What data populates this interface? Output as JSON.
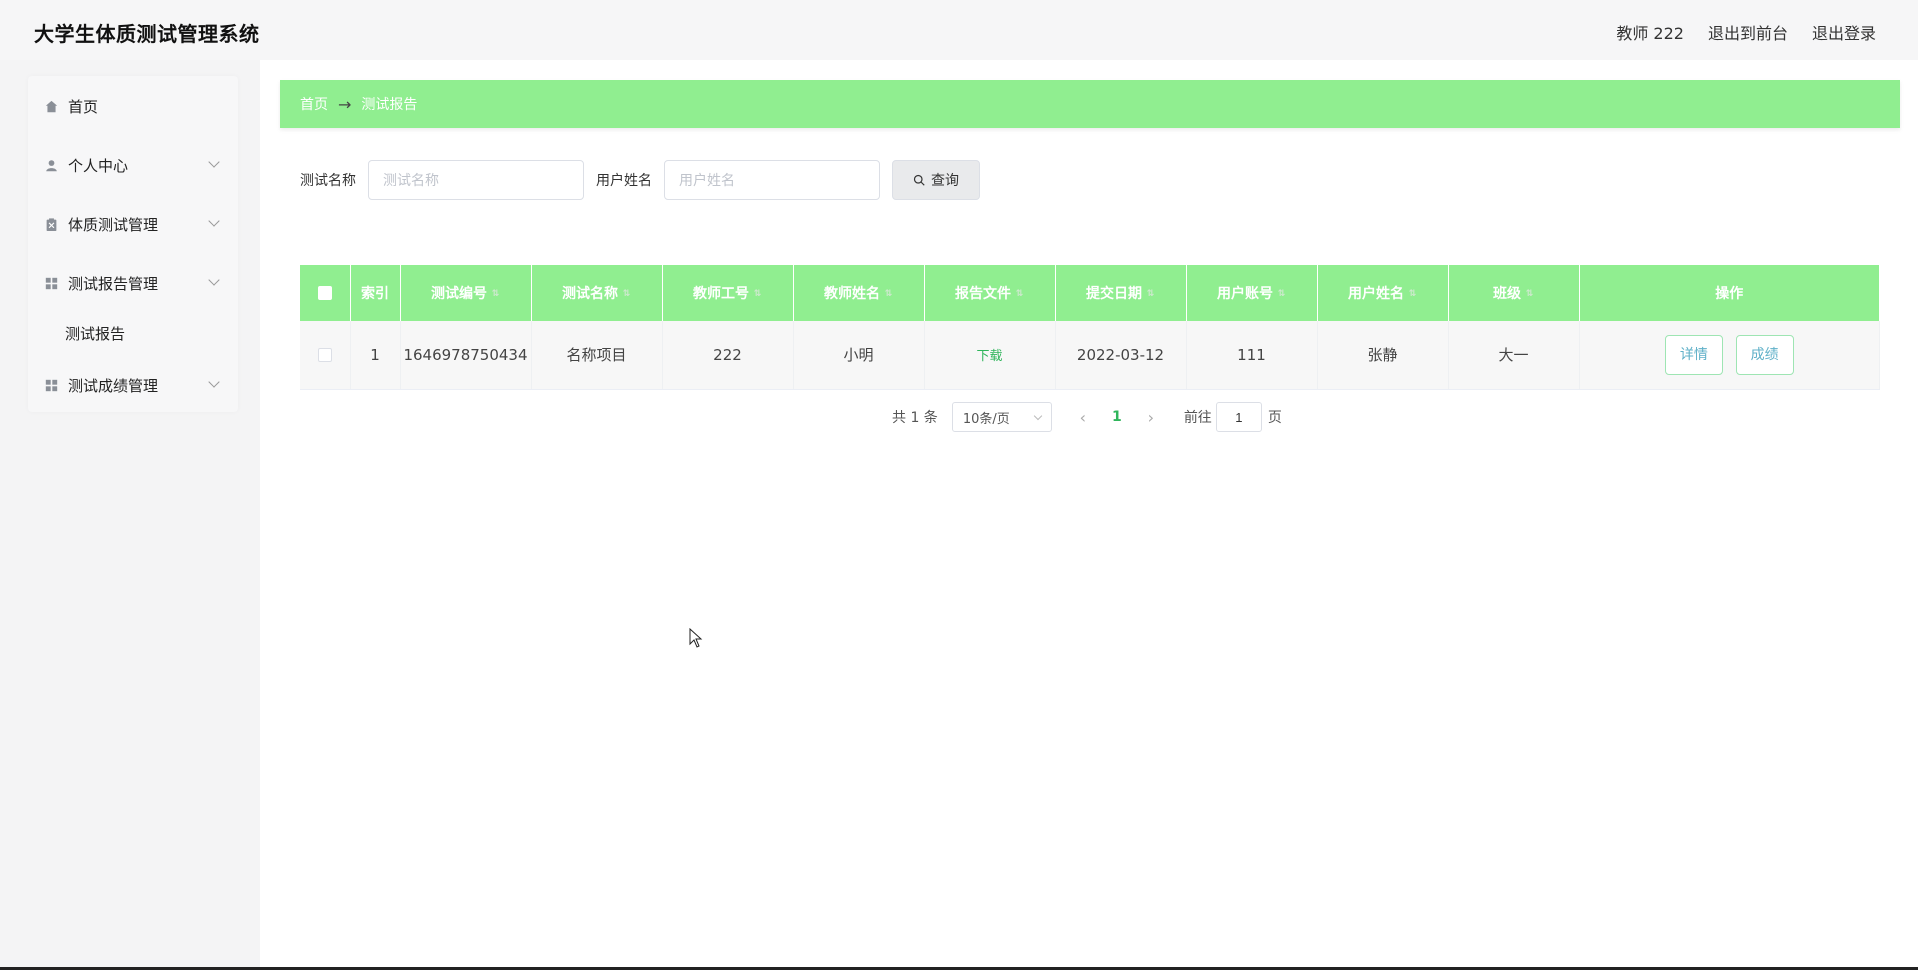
{
  "app": {
    "title": "大学生体质测试管理系统"
  },
  "header": {
    "user": "教师 222",
    "to_front": "退出到前台",
    "logout": "退出登录"
  },
  "sidebar": {
    "items": [
      {
        "label": "首页"
      },
      {
        "label": "个人中心"
      },
      {
        "label": "体质测试管理"
      },
      {
        "label": "测试报告管理"
      },
      {
        "label": "测试成绩管理"
      }
    ],
    "submenu": {
      "label": "测试报告"
    }
  },
  "breadcrumb": {
    "home": "首页",
    "arrow": "→",
    "current": "测试报告"
  },
  "search": {
    "test_name_label": "测试名称",
    "test_name_placeholder": "测试名称",
    "user_name_label": "用户姓名",
    "user_name_placeholder": "用户姓名",
    "query_label": "查询"
  },
  "table": {
    "headers": [
      "索引",
      "测试编号",
      "测试名称",
      "教师工号",
      "教师姓名",
      "报告文件",
      "提交日期",
      "用户账号",
      "用户姓名",
      "班级",
      "操作"
    ],
    "rows": [
      {
        "index": "1",
        "test_no": "1646978750434",
        "test_name": "名称项目",
        "teacher_no": "222",
        "teacher_name": "小明",
        "report_file": "下载",
        "submit_date": "2022-03-12",
        "user_account": "111",
        "user_name": "张静",
        "class": "大一",
        "detail": "详情",
        "score": "成绩"
      }
    ]
  },
  "pagination": {
    "total": "共 1 条",
    "page_size": "10条/页",
    "current_page": "1",
    "goto_label": "前往",
    "goto_value": "1",
    "page_suffix": "页"
  }
}
